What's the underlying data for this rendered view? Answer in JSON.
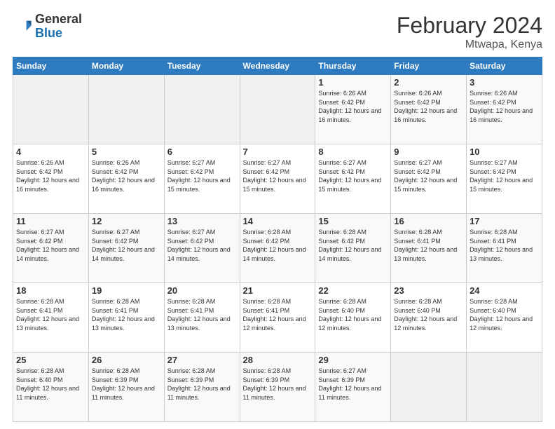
{
  "header": {
    "logo_general": "General",
    "logo_blue": "Blue",
    "month_year": "February 2024",
    "location": "Mtwapa, Kenya"
  },
  "days_of_week": [
    "Sunday",
    "Monday",
    "Tuesday",
    "Wednesday",
    "Thursday",
    "Friday",
    "Saturday"
  ],
  "weeks": [
    [
      {
        "day": "",
        "info": ""
      },
      {
        "day": "",
        "info": ""
      },
      {
        "day": "",
        "info": ""
      },
      {
        "day": "",
        "info": ""
      },
      {
        "day": "1",
        "info": "Sunrise: 6:26 AM\nSunset: 6:42 PM\nDaylight: 12 hours and 16 minutes."
      },
      {
        "day": "2",
        "info": "Sunrise: 6:26 AM\nSunset: 6:42 PM\nDaylight: 12 hours and 16 minutes."
      },
      {
        "day": "3",
        "info": "Sunrise: 6:26 AM\nSunset: 6:42 PM\nDaylight: 12 hours and 16 minutes."
      }
    ],
    [
      {
        "day": "4",
        "info": "Sunrise: 6:26 AM\nSunset: 6:42 PM\nDaylight: 12 hours and 16 minutes."
      },
      {
        "day": "5",
        "info": "Sunrise: 6:26 AM\nSunset: 6:42 PM\nDaylight: 12 hours and 16 minutes."
      },
      {
        "day": "6",
        "info": "Sunrise: 6:27 AM\nSunset: 6:42 PM\nDaylight: 12 hours and 15 minutes."
      },
      {
        "day": "7",
        "info": "Sunrise: 6:27 AM\nSunset: 6:42 PM\nDaylight: 12 hours and 15 minutes."
      },
      {
        "day": "8",
        "info": "Sunrise: 6:27 AM\nSunset: 6:42 PM\nDaylight: 12 hours and 15 minutes."
      },
      {
        "day": "9",
        "info": "Sunrise: 6:27 AM\nSunset: 6:42 PM\nDaylight: 12 hours and 15 minutes."
      },
      {
        "day": "10",
        "info": "Sunrise: 6:27 AM\nSunset: 6:42 PM\nDaylight: 12 hours and 15 minutes."
      }
    ],
    [
      {
        "day": "11",
        "info": "Sunrise: 6:27 AM\nSunset: 6:42 PM\nDaylight: 12 hours and 14 minutes."
      },
      {
        "day": "12",
        "info": "Sunrise: 6:27 AM\nSunset: 6:42 PM\nDaylight: 12 hours and 14 minutes."
      },
      {
        "day": "13",
        "info": "Sunrise: 6:27 AM\nSunset: 6:42 PM\nDaylight: 12 hours and 14 minutes."
      },
      {
        "day": "14",
        "info": "Sunrise: 6:28 AM\nSunset: 6:42 PM\nDaylight: 12 hours and 14 minutes."
      },
      {
        "day": "15",
        "info": "Sunrise: 6:28 AM\nSunset: 6:42 PM\nDaylight: 12 hours and 14 minutes."
      },
      {
        "day": "16",
        "info": "Sunrise: 6:28 AM\nSunset: 6:41 PM\nDaylight: 12 hours and 13 minutes."
      },
      {
        "day": "17",
        "info": "Sunrise: 6:28 AM\nSunset: 6:41 PM\nDaylight: 12 hours and 13 minutes."
      }
    ],
    [
      {
        "day": "18",
        "info": "Sunrise: 6:28 AM\nSunset: 6:41 PM\nDaylight: 12 hours and 13 minutes."
      },
      {
        "day": "19",
        "info": "Sunrise: 6:28 AM\nSunset: 6:41 PM\nDaylight: 12 hours and 13 minutes."
      },
      {
        "day": "20",
        "info": "Sunrise: 6:28 AM\nSunset: 6:41 PM\nDaylight: 12 hours and 13 minutes."
      },
      {
        "day": "21",
        "info": "Sunrise: 6:28 AM\nSunset: 6:41 PM\nDaylight: 12 hours and 12 minutes."
      },
      {
        "day": "22",
        "info": "Sunrise: 6:28 AM\nSunset: 6:40 PM\nDaylight: 12 hours and 12 minutes."
      },
      {
        "day": "23",
        "info": "Sunrise: 6:28 AM\nSunset: 6:40 PM\nDaylight: 12 hours and 12 minutes."
      },
      {
        "day": "24",
        "info": "Sunrise: 6:28 AM\nSunset: 6:40 PM\nDaylight: 12 hours and 12 minutes."
      }
    ],
    [
      {
        "day": "25",
        "info": "Sunrise: 6:28 AM\nSunset: 6:40 PM\nDaylight: 12 hours and 11 minutes."
      },
      {
        "day": "26",
        "info": "Sunrise: 6:28 AM\nSunset: 6:39 PM\nDaylight: 12 hours and 11 minutes."
      },
      {
        "day": "27",
        "info": "Sunrise: 6:28 AM\nSunset: 6:39 PM\nDaylight: 12 hours and 11 minutes."
      },
      {
        "day": "28",
        "info": "Sunrise: 6:28 AM\nSunset: 6:39 PM\nDaylight: 12 hours and 11 minutes."
      },
      {
        "day": "29",
        "info": "Sunrise: 6:27 AM\nSunset: 6:39 PM\nDaylight: 12 hours and 11 minutes."
      },
      {
        "day": "",
        "info": ""
      },
      {
        "day": "",
        "info": ""
      }
    ]
  ]
}
